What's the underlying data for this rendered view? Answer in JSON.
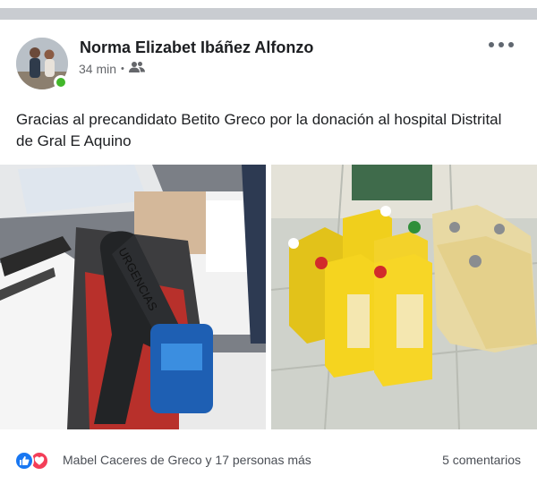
{
  "post": {
    "author": "Norma Elizabet Ibáñez Alfonzo",
    "time": "34 min",
    "audience_icon": "friends-icon",
    "text": "Gracias al precandidato Betito Greco  por la donación al hospital Distrital de Gral E Aquino",
    "photos": [
      {
        "icon": "thermometer-box-photo",
        "printed_text": "URGENCIAS"
      },
      {
        "icon": "bleach-jugs-photo"
      }
    ]
  },
  "reactions": {
    "icons": [
      "like-icon",
      "love-icon"
    ],
    "summary": "Mabel Caceres de Greco y 17 personas más",
    "comments": "5 comentarios"
  },
  "colors": {
    "like": "#1877f2",
    "love": "#f33e58",
    "online": "#42b72a",
    "secondary_text": "#65676b"
  }
}
